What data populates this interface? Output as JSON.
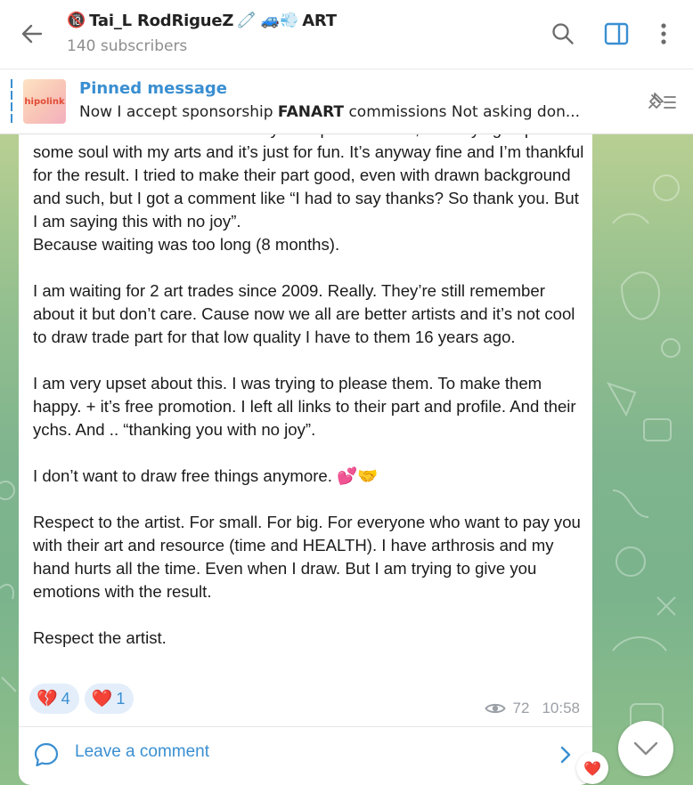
{
  "header": {
    "title_prefix_emoji": "🔞",
    "title_name": "Tai_L RodRiguеZ",
    "title_suffix_emojis": "🧷 🚙💨",
    "title_suffix_text": "ART",
    "subscribers": "140 subscribers"
  },
  "pinned": {
    "label": "Pinned message",
    "thumb_text": "hipolink",
    "text_before": "Now I accept sponsorship ",
    "text_bold": "FANART",
    "text_after": " commissions   Not asking  don..."
  },
  "message": {
    "paragraphs": [
      "about a week . I don’t want to say their part was bad, I am trying to put some soul with my arts and it’s just for fun. It’s anyway fine and I’m thankful for the result. I tried to make their part good, even with drawn background and such, but I got a comment like “I had to say thanks? So thank you. But I am saying this with no joy”.",
      "Because waiting was too long (8 months).",
      "I am waiting for 2 art trades since 2009. Really. They’re still remember about it but don’t care. Cause now we all are better artists and it’s not cool to draw trade part for that low quality I have to them 16 years ago.",
      "I am very upset about this. I was trying to please them. To make them happy. + it’s free promotion. I left all links to their part and profile. And their ychs. And .. “thanking you with no joy”.",
      "I don’t want to draw free things anymore. 💕🤝",
      "Respect to the artist. For small. For big. For everyone who want to pay you with their art and resource (time and HEALTH). I have arthrosis and my hand hurts all the time. Even when I draw. But I am trying to give you emotions with the result.",
      "Respect the artist."
    ],
    "reactions": [
      {
        "emoji": "💔",
        "count": "4"
      },
      {
        "emoji": "❤️",
        "count": "1"
      }
    ],
    "views": "72",
    "time": "10:58"
  },
  "comments": {
    "label": "Leave a comment"
  },
  "floating": {
    "heart": "❤️"
  },
  "colors": {
    "accent": "#3a8fd1",
    "reaction_bg": "#e3eefa",
    "wallpaper": "#8fbf8a"
  },
  "icons": [
    "back-arrow-icon",
    "search-icon",
    "sidebar-panel-icon",
    "more-vertical-icon",
    "unpin-icon",
    "eye-icon",
    "comment-bubble-icon",
    "chevron-right-icon",
    "chevron-down-icon"
  ]
}
